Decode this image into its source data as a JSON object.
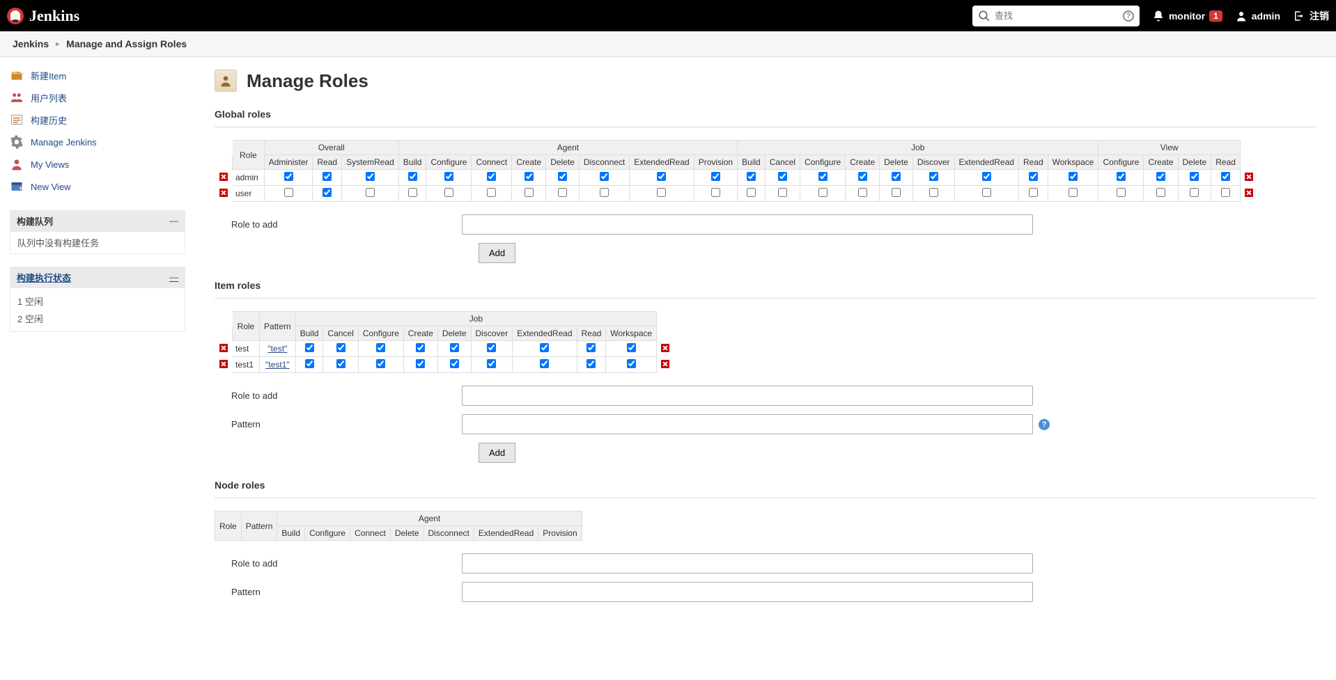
{
  "header": {
    "brand": "Jenkins",
    "search_placeholder": "查找",
    "notif_user": "monitor",
    "notif_count": "1",
    "admin_user": "admin",
    "logout": "注销"
  },
  "breadcrumb": {
    "root": "Jenkins",
    "page": "Manage and Assign Roles"
  },
  "sidebar": {
    "links": [
      {
        "key": "new-item",
        "label": "新建Item"
      },
      {
        "key": "people",
        "label": "用户列表"
      },
      {
        "key": "build-history",
        "label": "构建历史"
      },
      {
        "key": "manage",
        "label": "Manage Jenkins"
      },
      {
        "key": "my-views",
        "label": "My Views"
      },
      {
        "key": "new-view",
        "label": "New View"
      }
    ],
    "queue": {
      "title": "构建队列",
      "empty": "队列中没有构建任务"
    },
    "executors": {
      "title": "构建执行状态",
      "items": [
        {
          "num": "1",
          "state": "空闲"
        },
        {
          "num": "2",
          "state": "空闲"
        }
      ]
    }
  },
  "page_title": "Manage Roles",
  "sections": {
    "global": {
      "title": "Global roles",
      "groups": [
        {
          "name": "Overall",
          "cols": [
            "Administer",
            "Read",
            "SystemRead"
          ]
        },
        {
          "name": "Agent",
          "cols": [
            "Build",
            "Configure",
            "Connect",
            "Create",
            "Delete",
            "Disconnect",
            "ExtendedRead",
            "Provision"
          ]
        },
        {
          "name": "Job",
          "cols": [
            "Build",
            "Cancel",
            "Configure",
            "Create",
            "Delete",
            "Discover",
            "ExtendedRead",
            "Read",
            "Workspace"
          ]
        },
        {
          "name": "View",
          "cols": [
            "Configure",
            "Create",
            "Delete",
            "Read"
          ]
        }
      ],
      "rows": [
        {
          "name": "admin",
          "checked": [
            true,
            true,
            true,
            true,
            true,
            true,
            true,
            true,
            true,
            true,
            true,
            true,
            true,
            true,
            true,
            true,
            true,
            true,
            true,
            true,
            true,
            true,
            true,
            true
          ]
        },
        {
          "name": "user",
          "checked": [
            false,
            true,
            false,
            false,
            false,
            false,
            false,
            false,
            false,
            false,
            false,
            false,
            false,
            false,
            false,
            false,
            false,
            false,
            false,
            false,
            false,
            false,
            false,
            false
          ]
        }
      ],
      "role_to_add_label": "Role to add",
      "add_btn": "Add"
    },
    "item": {
      "title": "Item roles",
      "role_h": "Role",
      "pattern_h": "Pattern",
      "group": {
        "name": "Job",
        "cols": [
          "Build",
          "Cancel",
          "Configure",
          "Create",
          "Delete",
          "Discover",
          "ExtendedRead",
          "Read",
          "Workspace"
        ]
      },
      "rows": [
        {
          "name": "test",
          "pattern": "\"test\"",
          "checked": [
            true,
            true,
            true,
            true,
            true,
            true,
            true,
            true,
            true
          ]
        },
        {
          "name": "test1",
          "pattern": "\"test1\"",
          "checked": [
            true,
            true,
            true,
            true,
            true,
            true,
            true,
            true,
            true
          ]
        }
      ],
      "role_to_add_label": "Role to add",
      "pattern_label": "Pattern",
      "add_btn": "Add"
    },
    "node": {
      "title": "Node roles",
      "role_h": "Role",
      "pattern_h": "Pattern",
      "group": {
        "name": "Agent",
        "cols": [
          "Build",
          "Configure",
          "Connect",
          "Delete",
          "Disconnect",
          "ExtendedRead",
          "Provision"
        ]
      },
      "role_to_add_label": "Role to add",
      "pattern_label": "Pattern"
    }
  }
}
